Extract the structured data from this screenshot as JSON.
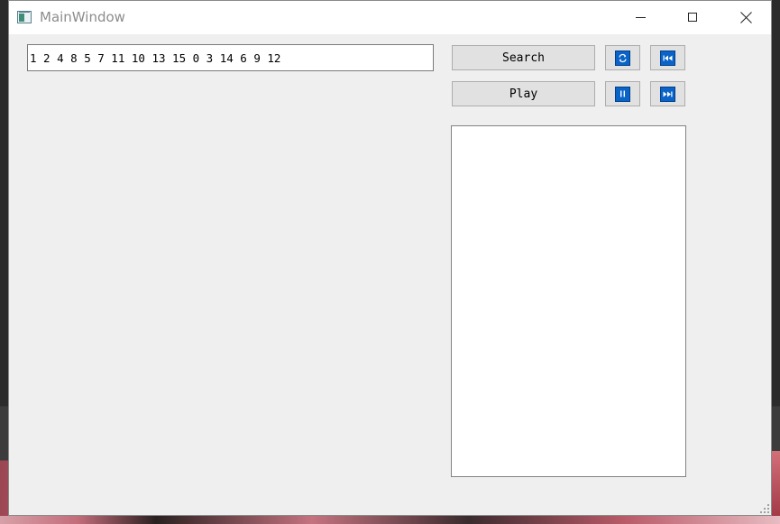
{
  "window": {
    "title": "MainWindow"
  },
  "input": {
    "sequence_value": "1 2 4 8 5 7 11 10 13 15 0 3 14 6 9 12"
  },
  "buttons": {
    "search_label": "Search",
    "play_label": "Play",
    "refresh_icon": "refresh-icon",
    "prev_icon": "skip-back-icon",
    "pause_icon": "pause-icon",
    "next_icon": "skip-forward-icon"
  },
  "colors": {
    "icon_blue": "#0a64c8",
    "button_face": "#e1e1e1",
    "client_bg": "#efefef"
  }
}
